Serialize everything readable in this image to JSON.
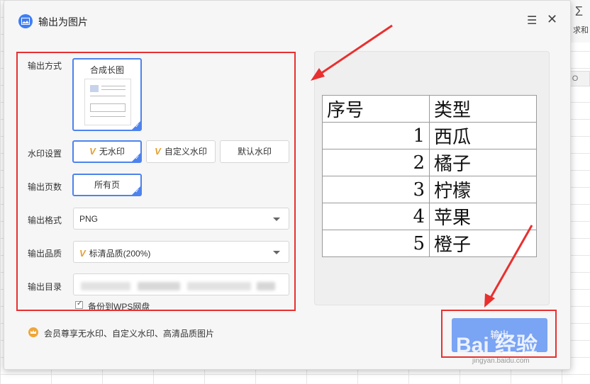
{
  "dialog": {
    "title": "输出为图片",
    "menu_icon": "menu-icon",
    "close_icon": "close-icon"
  },
  "background": {
    "sum_label": "求和",
    "column_label": "O"
  },
  "output_mode": {
    "label": "输出方式",
    "option": "合成长图",
    "selected": true
  },
  "watermark_setting": {
    "label": "水印设置",
    "options": [
      {
        "label": "无水印",
        "vip": true,
        "selected": true
      },
      {
        "label": "自定义水印",
        "vip": true,
        "selected": false
      },
      {
        "label": "默认水印",
        "vip": false,
        "selected": false
      }
    ]
  },
  "output_pages": {
    "label": "输出页数",
    "option": "所有页",
    "selected": true
  },
  "output_format": {
    "label": "输出格式",
    "value": "PNG"
  },
  "output_quality": {
    "label": "输出品质",
    "value": "标清品质(200%)",
    "vip": true
  },
  "output_directory": {
    "label": "输出目录"
  },
  "backup": {
    "label": "备份到WPS网盘",
    "checked": true
  },
  "member_note": "会员尊享无水印、自定义水印、高清品质图片",
  "preview_table": {
    "headers": [
      "序号",
      "类型"
    ],
    "rows": [
      {
        "seq": "1",
        "type": "西瓜"
      },
      {
        "seq": "2",
        "type": "橘子"
      },
      {
        "seq": "3",
        "type": "柠檬"
      },
      {
        "seq": "4",
        "type": "苹果"
      },
      {
        "seq": "5",
        "type": "橙子"
      }
    ]
  },
  "export_button": {
    "label": "输出"
  },
  "watermark_overlay": {
    "logo": "Bai 经验",
    "url": "jingyan.baidu.com"
  },
  "colors": {
    "accent": "#4d83ee",
    "annotation_red": "#e8302f",
    "export_button": "#7aa4f4",
    "vip_gold": "#e4a032"
  }
}
